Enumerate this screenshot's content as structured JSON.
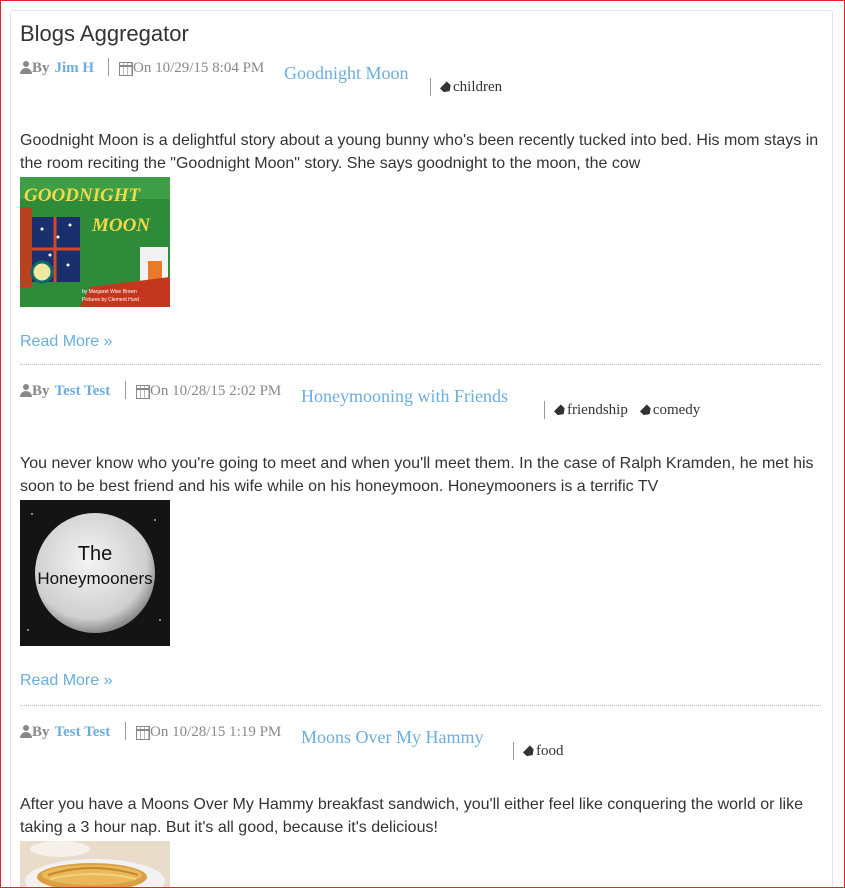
{
  "page": {
    "title": "Blogs Aggregator"
  },
  "posts": [
    {
      "by_label": "By",
      "author": "Jim H",
      "date": "On 10/29/15 8:04 PM",
      "title": "Goodnight Moon",
      "tags": [
        "children"
      ],
      "excerpt": "Goodnight Moon is a delightful story about a young bunny who's been recently tucked into bed. His mom stays in the room reciting the \"Goodnight Moon\" story. She says goodnight to the moon, the cow",
      "image_text": "GOODNIGHT MOON",
      "image_subtext": "by Margaret Wise Brown · Pictures by Clement Hurd",
      "read_more": "Read More »"
    },
    {
      "by_label": "By",
      "author": "Test Test",
      "date": "On 10/28/15 2:02 PM",
      "title": "Honeymooning with Friends",
      "tags": [
        "friendship",
        "comedy"
      ],
      "excerpt": "You never know who you're going to meet and when you'll meet them. In the case of Ralph Kramden, he met his soon to be best friend and his wife while on his honeymoon. Honeymooners is a terrific TV",
      "image_text_1": "The",
      "image_text_2": "Honeymooners",
      "read_more": "Read More »"
    },
    {
      "by_label": "By",
      "author": "Test Test",
      "date": "On 10/28/15 1:19 PM",
      "title": "Moons Over My Hammy",
      "tags": [
        "food"
      ],
      "excerpt": "After you have a Moons Over My Hammy breakfast sandwich, you'll either feel like conquering the world or like taking a 3 hour nap. But it's all good, because it's delicious!"
    }
  ],
  "colors": {
    "link": "#6aaedd",
    "muted": "#888888",
    "frame": "#d9262d"
  }
}
